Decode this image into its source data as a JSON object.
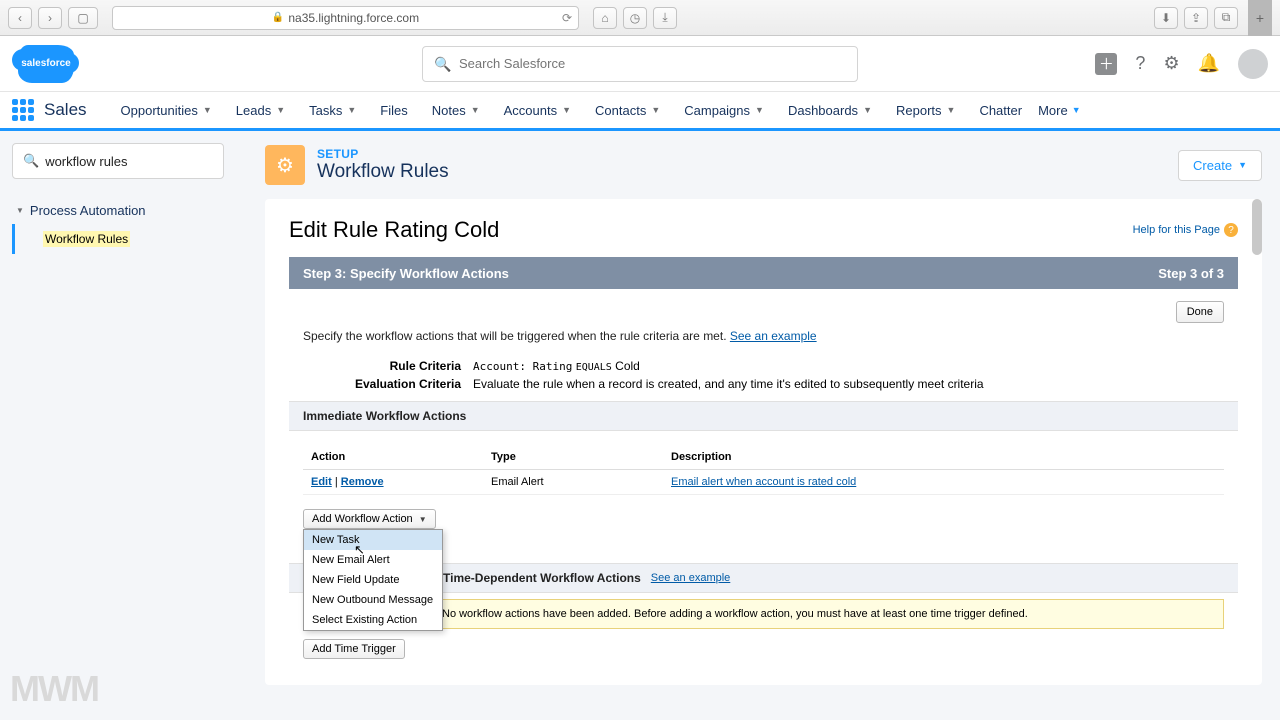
{
  "browser": {
    "url": "na35.lightning.force.com"
  },
  "header": {
    "search_placeholder": "Search Salesforce"
  },
  "nav": {
    "app_name": "Sales",
    "items": [
      "Opportunities",
      "Leads",
      "Tasks",
      "Files",
      "Notes",
      "Accounts",
      "Contacts",
      "Campaigns",
      "Dashboards",
      "Reports",
      "Chatter"
    ],
    "more": "More"
  },
  "sidebar": {
    "quickfind": "workflow rules",
    "section": "Process Automation",
    "item": "Workflow Rules"
  },
  "page": {
    "setup_label": "SETUP",
    "title": "Workflow Rules",
    "create": "Create"
  },
  "rule": {
    "heading": "Edit Rule Rating Cold",
    "help": "Help for this Page",
    "step_left": "Step 3: Specify Workflow Actions",
    "step_right": "Step 3 of 3",
    "done": "Done",
    "instruction": "Specify the workflow actions that will be triggered when the rule criteria are met.",
    "see_example": "See an example",
    "criteria": {
      "rule_label": "Rule Criteria",
      "rule_value_pre": "Account: Rating",
      "rule_value_op": "EQUALS",
      "rule_value_post": "Cold",
      "eval_label": "Evaluation Criteria",
      "eval_value": "Evaluate the rule when a record is created, and any time it's edited to subsequently meet criteria"
    },
    "immediate": {
      "title": "Immediate Workflow Actions",
      "cols": {
        "action": "Action",
        "type": "Type",
        "desc": "Description"
      },
      "row": {
        "edit": "Edit",
        "remove": "Remove",
        "type": "Email Alert",
        "desc": "Email alert when account is rated cold"
      },
      "add_button": "Add Workflow Action",
      "dropdown": [
        "New Task",
        "New Email Alert",
        "New Field Update",
        "New Outbound Message",
        "Select Existing Action"
      ]
    },
    "timedep": {
      "title": "Time-Dependent Workflow Actions",
      "see_example": "See an example",
      "notice": "No workflow actions have been added. Before adding a workflow action, you must have at least one time trigger defined.",
      "add_trigger": "Add Time Trigger"
    }
  },
  "watermark": "MWM"
}
